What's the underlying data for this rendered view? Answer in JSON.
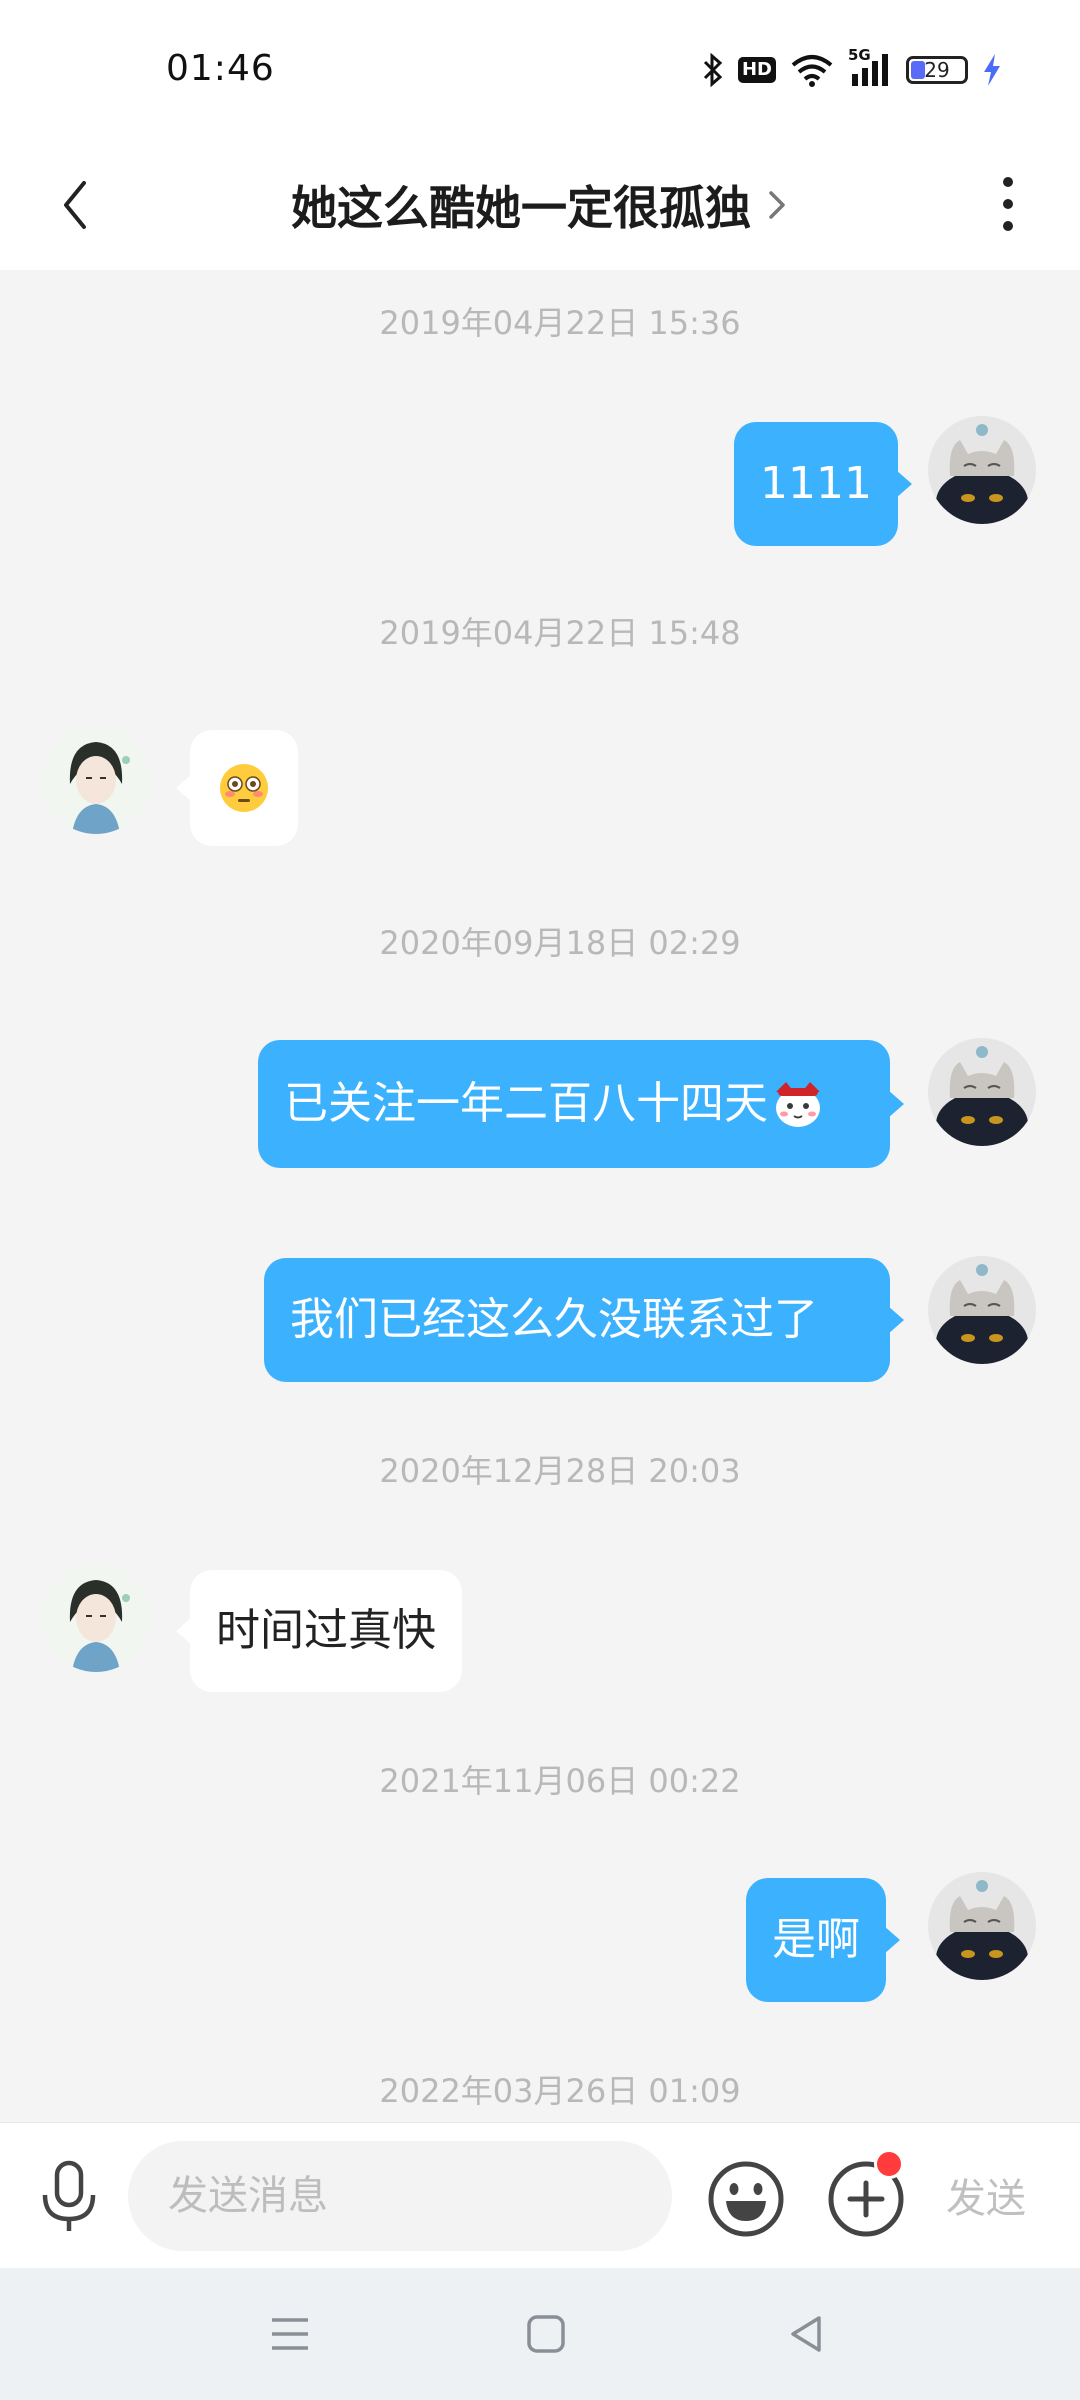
{
  "status_bar": {
    "time": "01:46",
    "network": "5G",
    "hd": "HD",
    "battery": "29",
    "battery_color": "#5a6cf5",
    "charging_color": "#4a6cf7"
  },
  "header": {
    "title": "她这么酷她一定很孤独",
    "back_icon": "chevron-left-icon",
    "more_icon": "more-vertical-icon"
  },
  "messages": [
    {
      "type": "timestamp",
      "text": "2019年04月22日 15:36"
    },
    {
      "type": "msg",
      "from": "me",
      "text": "1111"
    },
    {
      "type": "timestamp",
      "text": "2019年04月22日 15:48"
    },
    {
      "type": "msg",
      "from": "other",
      "emoji": "flushed-face-emoji"
    },
    {
      "type": "timestamp",
      "text": "2020年09月18日 02:29"
    },
    {
      "type": "msg",
      "from": "me",
      "text": "已关注一年二百八十四天",
      "sticker": "cartoon-face-sticker"
    },
    {
      "type": "msg",
      "from": "me",
      "text": "我们已经这么久没联系过了"
    },
    {
      "type": "timestamp",
      "text": "2020年12月28日 20:03"
    },
    {
      "type": "msg",
      "from": "other",
      "text": "时间过真快"
    },
    {
      "type": "timestamp",
      "text": "2021年11月06日 00:22"
    },
    {
      "type": "msg",
      "from": "me",
      "text": "是啊"
    },
    {
      "type": "timestamp",
      "text": "2022年03月26日 01:09"
    }
  ],
  "composer": {
    "placeholder": "发送消息",
    "send_label": "发送",
    "mic_icon": "microphone-icon",
    "emoji_icon": "smiley-icon",
    "plus_icon": "plus-circle-icon",
    "notification_dot_color": "#ff3b3b"
  },
  "nav": {
    "menu_icon": "menu-icon",
    "home_icon": "home-square-icon",
    "back_icon": "back-triangle-icon"
  },
  "colors": {
    "my_bubble": "#3cb2ff",
    "other_bubble": "#ffffff",
    "chat_background": "#f4f4f4"
  }
}
